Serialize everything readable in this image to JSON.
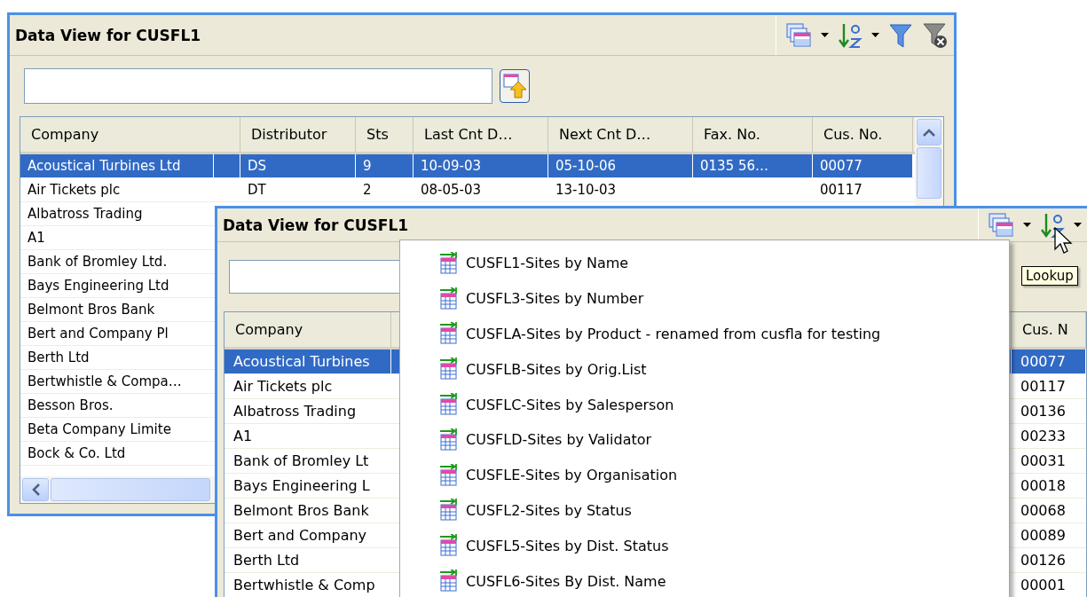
{
  "back_window": {
    "title": "Data View for CUSFL1",
    "columns": [
      "Company",
      "Distributor",
      "Sts",
      "Last Cnt D…",
      "Next Cnt D…",
      "Fax. No.",
      "Cus. No."
    ],
    "rows": [
      {
        "selected": true,
        "cells": [
          "Acoustical Turbines Ltd",
          "DS",
          "9",
          "10-09-03",
          "05-10-06",
          "0135 56…",
          "00077"
        ]
      },
      {
        "selected": false,
        "cells": [
          "Air Tickets plc",
          "DT",
          "2",
          "08-05-03",
          "13-10-03",
          null,
          "00117"
        ]
      },
      {
        "selected": false,
        "cells": [
          "Albatross Trading"
        ]
      },
      {
        "selected": false,
        "cells": [
          "A1"
        ]
      },
      {
        "selected": false,
        "cells": [
          "Bank of Bromley Ltd."
        ]
      },
      {
        "selected": false,
        "cells": [
          "Bays Engineering Ltd"
        ]
      },
      {
        "selected": false,
        "cells": [
          "Belmont Bros Bank"
        ]
      },
      {
        "selected": false,
        "cells": [
          "Bert and Company Pl"
        ]
      },
      {
        "selected": false,
        "cells": [
          "Berth Ltd"
        ]
      },
      {
        "selected": false,
        "cells": [
          "Bertwhistle & Compa…"
        ]
      },
      {
        "selected": false,
        "cells": [
          "Besson Bros."
        ]
      },
      {
        "selected": false,
        "cells": [
          "Beta Company Limite"
        ]
      },
      {
        "selected": false,
        "cells": [
          "Bock & Co. Ltd"
        ]
      }
    ]
  },
  "front_window": {
    "title": "Data View for CUSFL1",
    "columns": [
      "Company",
      "Cus. N"
    ],
    "rows": [
      {
        "selected": true,
        "cells": [
          "Acoustical Turbines",
          "00077"
        ]
      },
      {
        "selected": false,
        "cells": [
          "Air Tickets plc",
          "00117"
        ]
      },
      {
        "selected": false,
        "cells": [
          "Albatross Trading",
          "00136"
        ]
      },
      {
        "selected": false,
        "cells": [
          "A1",
          "00233"
        ]
      },
      {
        "selected": false,
        "cells": [
          "Bank of Bromley Lt",
          "00031"
        ]
      },
      {
        "selected": false,
        "cells": [
          "Bays Engineering L",
          "00018"
        ]
      },
      {
        "selected": false,
        "cells": [
          "Belmont Bros Bank",
          "00068"
        ]
      },
      {
        "selected": false,
        "cells": [
          "Bert and Company",
          "00089"
        ]
      },
      {
        "selected": false,
        "cells": [
          "Berth Ltd",
          "00126"
        ]
      },
      {
        "selected": false,
        "cells": [
          "Bertwhistle & Comp",
          "00001"
        ]
      }
    ]
  },
  "menu": {
    "items": [
      "CUSFL1-Sites by Name",
      "CUSFL3-Sites by Number",
      "CUSFLA-Sites by Product - renamed from cusfla for testing",
      "CUSFLB-Sites by Orig.List",
      "CUSFLC-Sites by Salesperson",
      "CUSFLD-Sites by Validator",
      "CUSFLE-Sites by Organisation",
      "CUSFL2-Sites by Status",
      "CUSFL5-Sites by Dist. Status",
      "CUSFL6-Sites By Dist. Name"
    ]
  },
  "tooltip": "Lookup"
}
